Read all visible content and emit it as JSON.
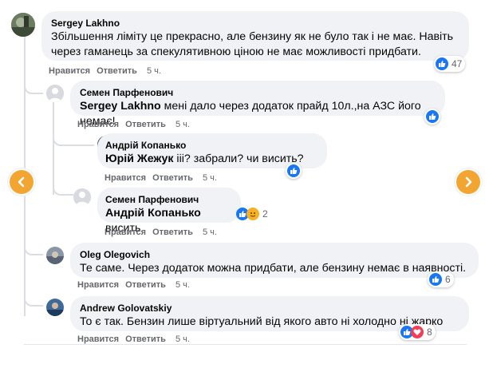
{
  "nav": {
    "prev_icon": "chevron-left-icon",
    "next_icon": "chevron-right-icon",
    "accent": "#f3a531"
  },
  "comments": [
    {
      "author": "Sergey Lakhno",
      "text": "Збільшення ліміту це прекрасно, але бензину як не було так і не має. Навіть через гаманець за спекулятивною ціною не має можливості придбати.",
      "line1": "Збільшення ліміту це прекрасно, але бензину як не було так і не має. Навіть",
      "line2": "через гаманець за спекулятивною ціною не має можливості придбати.",
      "like": "Нравится",
      "reply": "Ответить",
      "time": "5 ч.",
      "reactions": "47"
    },
    {
      "author": "Семен Парфенович",
      "mention": "Sergey Lakhno",
      "text": " мені дало через додаток прайд 10л.,на АЗС його немає!",
      "like": "Нравится",
      "reply": "Ответить",
      "time": "5 ч."
    },
    {
      "author": "Андрій Копанько",
      "mention": "Юрій Жежук",
      "text": " ііі? забрали? чи висить?",
      "like": "Нравится",
      "reply": "Ответить",
      "time": "5 ч."
    },
    {
      "author": "Семен Парфенович",
      "mention": "Андрій Копанько",
      "text": " висить",
      "like": "Нравится",
      "reply": "Ответить",
      "time": "5 ч.",
      "reactions": "2"
    },
    {
      "author": "Oleg Olegovich",
      "text": "Те саме. Через додаток можна придбати, але бензину немає в наявності.",
      "like": "Нравится",
      "reply": "Ответить",
      "time": "5 ч.",
      "reactions": "6"
    },
    {
      "author": "Andrew Golovatskiy",
      "text": "То є так. Бензин лише віртуальний від якого авто ні холодно ні жарко",
      "like": "Нравится",
      "reply": "Ответить",
      "time": "5 ч.",
      "reactions": "8"
    }
  ],
  "colors": {
    "like": "#1877f2",
    "love": "#f33e58",
    "care": "#f7b125",
    "bubble": "#f0f2f5",
    "meta": "#65676b"
  }
}
